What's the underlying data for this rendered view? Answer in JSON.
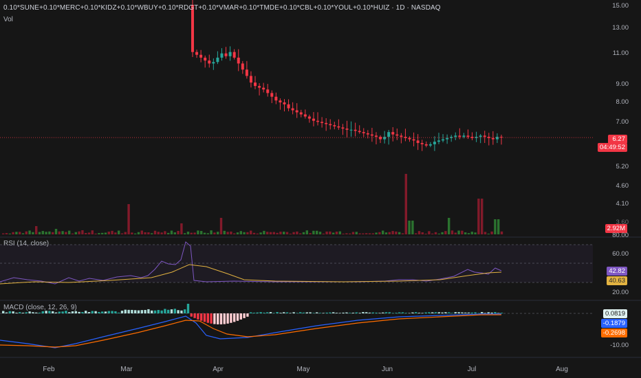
{
  "header": {
    "title": "0.10*SUNE+0.10*MERC+0.10*KIDZ+0.10*WBUY+0.10*RDGT+0.10*VMAR+0.10*TMDE+0.10*CBL+0.10*YOUL+0.10*HUIZ · 1D · NASDAQ",
    "sub": "Vol"
  },
  "colors": {
    "up": "#26a69a",
    "down": "#f23645",
    "background": "#161616",
    "rsi_line": "#7e57c2",
    "rsi_ma": "#e3b341",
    "macd_line": "#2962ff",
    "signal_line": "#ff6d00"
  },
  "price_axis": {
    "ticks": [
      "15.00",
      "13.00",
      "11.00",
      "9.00",
      "8.00",
      "7.00",
      "6.00",
      "5.20",
      "4.60",
      "4.10",
      "3.60"
    ],
    "last_price": "6.27",
    "countdown": "04:49:52"
  },
  "volume": {
    "last": "2.92M"
  },
  "rsi": {
    "label": "RSI (14, close)",
    "ticks": [
      "80.00",
      "60.00",
      "20.00"
    ],
    "value": "42.82",
    "ma_value": "40.63"
  },
  "macd": {
    "label": "MACD (close, 12, 26, 9)",
    "ticks": [
      "-10.00"
    ],
    "hist_value": "0.0819",
    "macd_value": "-0.1879",
    "signal_value": "-0.2698"
  },
  "x_axis": {
    "labels": [
      "Feb",
      "Mar",
      "Apr",
      "May",
      "Jun",
      "Jul",
      "Aug"
    ]
  },
  "chart_data": [
    {
      "type": "candlestick",
      "title": "",
      "series": [
        {
          "name": "price",
          "x": [
            "Mar 24",
            "Mar 25",
            "Mar 26",
            "Mar 27",
            "Mar 28",
            "Mar 31",
            "Apr 1",
            "Apr 2",
            "Apr 3",
            "Apr 4",
            "Apr 7",
            "Apr 8",
            "Apr 9",
            "Apr 10",
            "Apr 11",
            "Apr 14",
            "Apr 15",
            "Apr 16",
            "Apr 17",
            "Apr 21",
            "Apr 22",
            "Apr 23",
            "Apr 24",
            "Apr 25",
            "Apr 28",
            "Apr 29",
            "Apr 30",
            "May 1",
            "May 2",
            "May 5",
            "May 6",
            "May 7",
            "May 8",
            "May 9",
            "May 12",
            "May 13",
            "May 14",
            "May 15",
            "May 16",
            "May 19",
            "May 20",
            "May 21",
            "May 22",
            "May 23",
            "May 27",
            "May 28",
            "May 29",
            "May 30",
            "Jun 2",
            "Jun 3",
            "Jun 4",
            "Jun 5",
            "Jun 6",
            "Jun 9",
            "Jun 10",
            "Jun 11",
            "Jun 12",
            "Jun 13",
            "Jun 16",
            "Jun 17",
            "Jun 18",
            "Jun 20",
            "Jun 23",
            "Jun 24",
            "Jun 25",
            "Jun 26",
            "Jun 27",
            "Jun 30",
            "Jul 1",
            "Jul 2",
            "Jul 3",
            "Jul 7",
            "Jul 8",
            "Jul 9",
            "Jul 10"
          ],
          "open": [
            15.0,
            11.0,
            10.8,
            10.6,
            10.4,
            10.2,
            10.3,
            10.6,
            10.9,
            10.7,
            11.0,
            10.6,
            10.2,
            9.8,
            9.4,
            9.0,
            8.8,
            8.7,
            8.6,
            8.4,
            8.2,
            8.0,
            7.9,
            7.8,
            7.6,
            7.5,
            7.4,
            7.3,
            7.2,
            7.1,
            7.0,
            6.95,
            6.9,
            6.85,
            6.8,
            6.75,
            6.7,
            6.65,
            6.6,
            6.6,
            6.55,
            6.5,
            6.45,
            6.4,
            6.35,
            6.3,
            6.2,
            6.3,
            6.5,
            6.4,
            6.35,
            6.3,
            6.25,
            6.2,
            6.15,
            6.05,
            6.0,
            5.95,
            6.0,
            6.1,
            6.15,
            6.2,
            6.25,
            6.3,
            6.35,
            6.3,
            6.35,
            6.3,
            6.25,
            6.3,
            6.35,
            6.3,
            6.25,
            6.2,
            6.3
          ],
          "close": [
            11.0,
            10.8,
            10.6,
            10.4,
            10.2,
            10.3,
            10.6,
            10.9,
            10.7,
            11.0,
            10.6,
            10.2,
            9.8,
            9.4,
            9.0,
            8.8,
            8.7,
            8.6,
            8.4,
            8.2,
            8.0,
            7.9,
            7.8,
            7.6,
            7.5,
            7.4,
            7.3,
            7.2,
            7.1,
            7.0,
            6.95,
            6.9,
            6.85,
            6.8,
            6.75,
            6.7,
            6.65,
            6.6,
            6.6,
            6.55,
            6.5,
            6.45,
            6.4,
            6.35,
            6.3,
            6.2,
            6.3,
            6.5,
            6.4,
            6.35,
            6.3,
            6.25,
            6.2,
            6.15,
            6.05,
            6.0,
            5.95,
            6.0,
            6.1,
            6.15,
            6.2,
            6.25,
            6.3,
            6.35,
            6.3,
            6.35,
            6.3,
            6.25,
            6.3,
            6.35,
            6.3,
            6.25,
            6.2,
            6.3,
            6.27
          ]
        }
      ],
      "ylabel": "",
      "ylim": [
        3.6,
        15.0
      ],
      "scale": "log"
    },
    {
      "type": "bar",
      "title": "Vol",
      "series": [
        {
          "name": "Vol",
          "values": [
            2.92
          ]
        }
      ],
      "units": "M"
    },
    {
      "type": "line",
      "title": "RSI (14, close)",
      "series": [
        {
          "name": "RSI",
          "values": [
            42.82
          ]
        },
        {
          "name": "RSI MA",
          "values": [
            40.63
          ]
        }
      ],
      "ylim": [
        20,
        80
      ]
    },
    {
      "type": "line",
      "title": "MACD (close, 12, 26, 9)",
      "series": [
        {
          "name": "Histogram",
          "values": [
            0.0819
          ]
        },
        {
          "name": "MACD",
          "values": [
            -0.1879
          ]
        },
        {
          "name": "Signal",
          "values": [
            -0.2698
          ]
        }
      ]
    }
  ]
}
